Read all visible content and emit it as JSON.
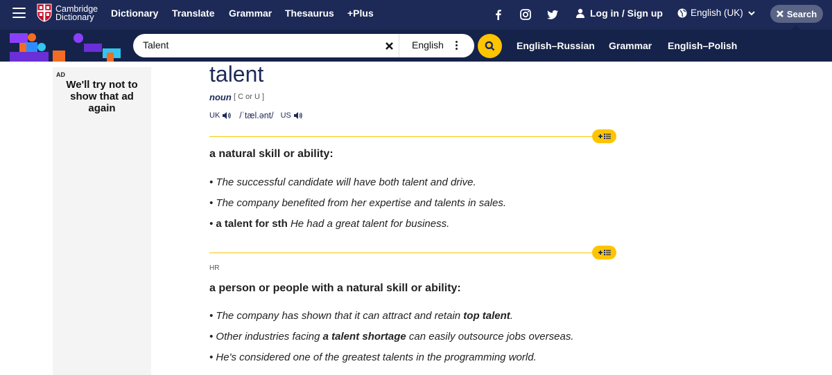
{
  "brand": {
    "line1": "Cambridge",
    "line2": "Dictionary"
  },
  "nav": [
    "Dictionary",
    "Translate",
    "Grammar",
    "Thesaurus",
    "+Plus"
  ],
  "header": {
    "login": "Log in / Sign up",
    "language": "English (UK)",
    "search_button": "Search"
  },
  "search": {
    "value": "Talent",
    "dictionary": "English"
  },
  "sublinks": [
    "English–Russian",
    "Grammar",
    "English–Polish"
  ],
  "ad": {
    "label": "AD",
    "text": "We'll try not to show that ad again"
  },
  "entry": {
    "headword": "talent",
    "pos": "noun",
    "grammar": "[ C or U ]",
    "uk_label": "UK",
    "ipa": "/ˈtæl.ənt/",
    "us_label": "US",
    "sense1": {
      "definition": "a natural skill or ability:",
      "ex1": "The successful candidate will have both talent and drive.",
      "ex2": "The company benefited from her expertise and talents in sales.",
      "ex3_phrase": "a talent for sth",
      "ex3_text": "He had a great talent for business."
    },
    "sense2": {
      "domain": "HR",
      "definition": "a person or people with a natural skill or ability:",
      "ex1_pre": "The company has shown that it can attract and retain ",
      "ex1_bold": "top talent",
      "ex1_post": ".",
      "ex2_pre": "Other industries facing ",
      "ex2_bold": "a talent shortage",
      "ex2_post": " can easily outsource jobs overseas.",
      "ex3": "He's considered one of the greatest talents in the programming world."
    }
  },
  "colors": {
    "navy": "#1d2a57",
    "dark_navy": "#15234a",
    "accent": "#fec400"
  },
  "icons": [
    "hamburger-icon",
    "cambridge-shield-icon",
    "facebook-icon",
    "instagram-icon",
    "twitter-icon",
    "user-icon",
    "globe-icon",
    "chevron-down-icon",
    "close-icon",
    "more-vertical-icon",
    "search-icon",
    "speaker-icon",
    "add-to-list-icon"
  ]
}
